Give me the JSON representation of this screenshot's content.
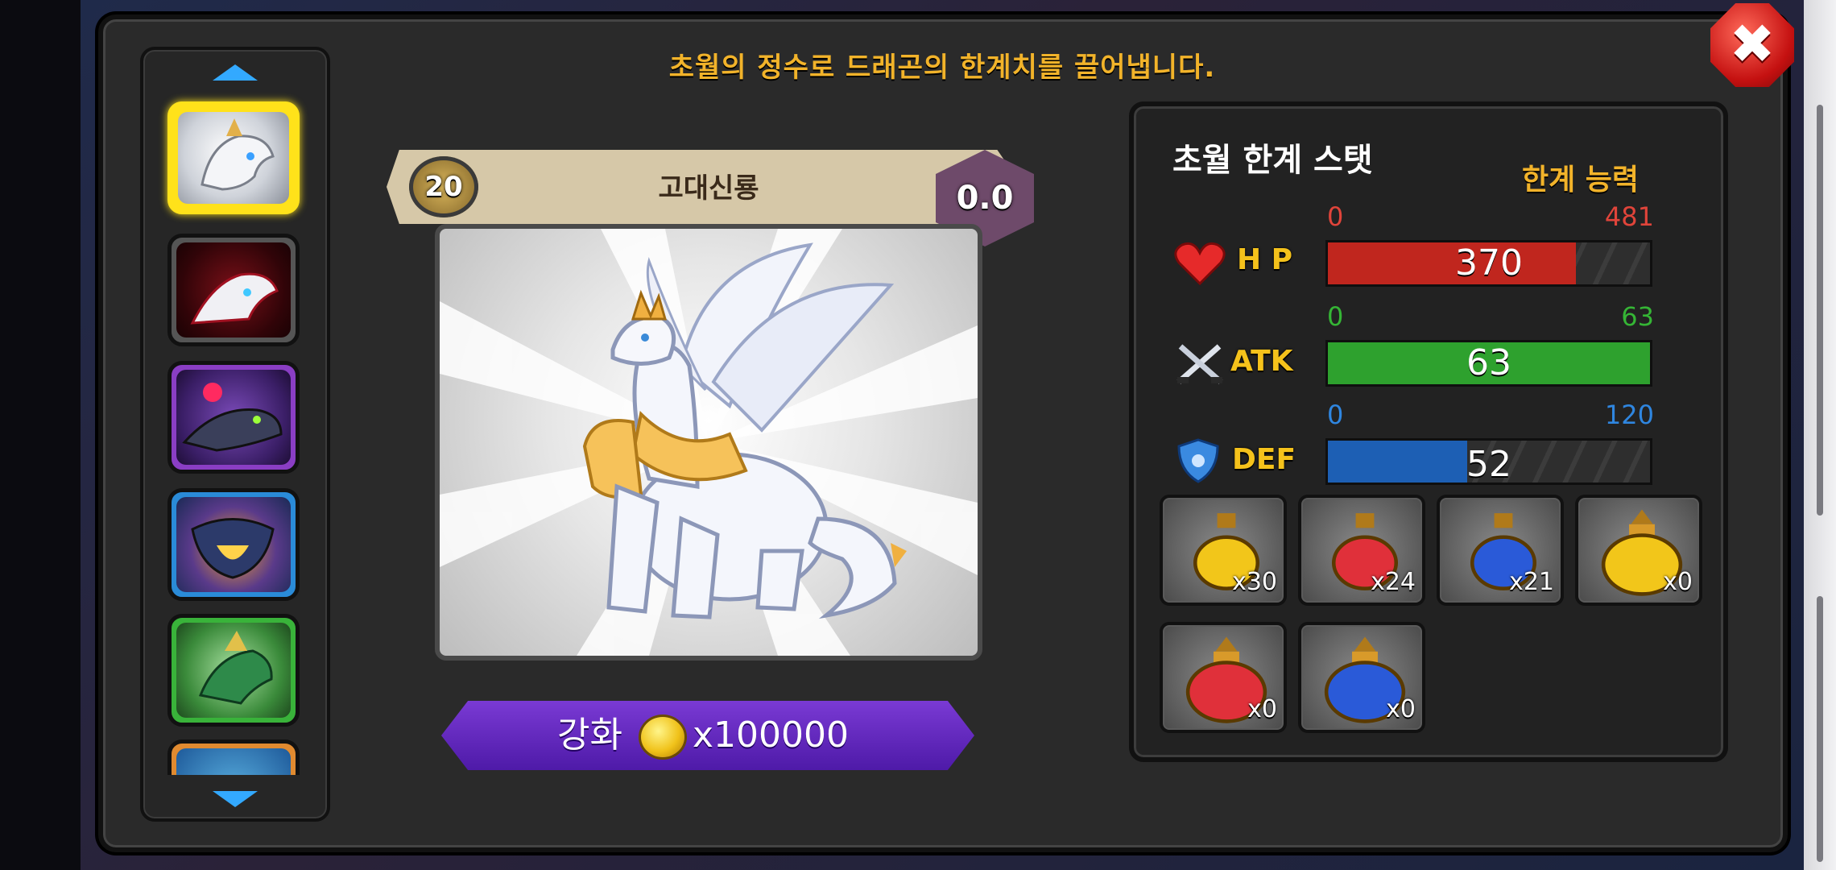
{
  "header": {
    "message": "초월의 정수로 드래곤의 한계치를 끌어냅니다."
  },
  "close_button": {
    "icon": "close-icon",
    "symbol": "✖"
  },
  "dragon_list": {
    "scroll_up_icon": "arrow-up-icon",
    "scroll_down_icon": "arrow-down-icon",
    "items": [
      {
        "name": "white-dragon",
        "selected": true,
        "frame_color": "#ffe21a"
      },
      {
        "name": "red-white-dragon",
        "selected": false,
        "frame_color": "#555555"
      },
      {
        "name": "purple-dragon",
        "selected": false,
        "frame_color": "#8a3ec4"
      },
      {
        "name": "blue-flame-dragon",
        "selected": false,
        "frame_color": "#2a8bd8"
      },
      {
        "name": "green-dragon",
        "selected": false,
        "frame_color": "#39b33a"
      },
      {
        "name": "orange-dragon",
        "selected": false,
        "frame_color": "#e08a30"
      }
    ]
  },
  "dragon_card": {
    "level": "20",
    "name": "고대신룡",
    "transcend_value": "0.0"
  },
  "upgrade": {
    "label": "강화",
    "currency_icon": "gold-coin-icon",
    "cost": "x100000"
  },
  "stats_panel": {
    "title": "초월 한계 스탯",
    "cap_label": "한계 능력",
    "stats": [
      {
        "key": "hp",
        "label": "H P",
        "icon": "heart-icon",
        "min": "0",
        "max": "481",
        "value": "370",
        "fraction": 0.769,
        "color": "#c0261e",
        "range_color": "#e0443a"
      },
      {
        "key": "atk",
        "label": "ATK",
        "icon": "crossed-swords-icon",
        "min": "0",
        "max": "63",
        "value": "63",
        "fraction": 1.0,
        "color": "#2ea12e",
        "range_color": "#35b535"
      },
      {
        "key": "def",
        "label": "DEF",
        "icon": "shield-icon",
        "min": "0",
        "max": "120",
        "value": "52",
        "fraction": 0.433,
        "color": "#1d5fb4",
        "range_color": "#2f86e0"
      }
    ]
  },
  "potions": [
    {
      "name": "small-yellow-potion",
      "count": "x30",
      "color": "#f2c61a"
    },
    {
      "name": "small-red-potion",
      "count": "x24",
      "color": "#e0303a"
    },
    {
      "name": "small-blue-potion",
      "count": "x21",
      "color": "#2a5ad8"
    },
    {
      "name": "large-yellow-potion",
      "count": "x0",
      "color": "#f2c61a"
    },
    {
      "name": "large-red-potion",
      "count": "x0",
      "color": "#e0303a"
    },
    {
      "name": "large-blue-potion",
      "count": "x0",
      "color": "#2a5ad8"
    }
  ]
}
